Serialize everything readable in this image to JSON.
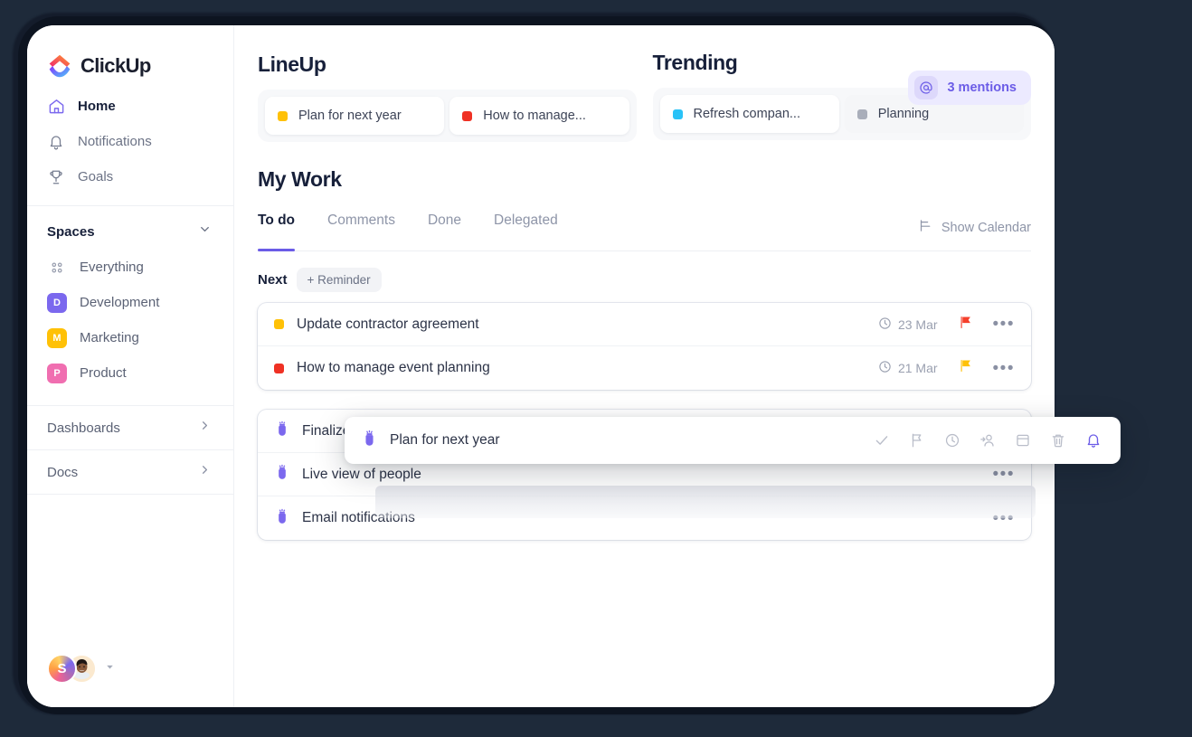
{
  "app": {
    "brand": "ClickUp"
  },
  "sidebar": {
    "nav": [
      {
        "label": "Home",
        "icon": "home-icon",
        "active": true
      },
      {
        "label": "Notifications",
        "icon": "bell-icon",
        "active": false
      },
      {
        "label": "Goals",
        "icon": "trophy-icon",
        "active": false
      }
    ],
    "spaces_title": "Spaces",
    "spaces": [
      {
        "label": "Everything",
        "badge": "",
        "color": "",
        "icon": "grid-dots-icon"
      },
      {
        "label": "Development",
        "badge": "D",
        "color": "#7b68ee"
      },
      {
        "label": "Marketing",
        "badge": "M",
        "color": "#ffc107"
      },
      {
        "label": "Product",
        "badge": "P",
        "color": "#f06eb0"
      }
    ],
    "sections": [
      {
        "label": "Dashboards",
        "icon": "chevron-right-icon"
      },
      {
        "label": "Docs",
        "icon": "chevron-right-icon"
      }
    ],
    "user": {
      "initial": "S",
      "avatar_alt": "user-photo"
    }
  },
  "lineup": {
    "title": "LineUp",
    "items": [
      {
        "label": "Plan for next year",
        "color": "#ffc107"
      },
      {
        "label": "How to manage...",
        "color": "#ef3124"
      }
    ]
  },
  "trending": {
    "title": "Trending",
    "items": [
      {
        "label": "Refresh compan...",
        "color": "#29c2f7"
      },
      {
        "label": "Planning",
        "color": "#a9aeba"
      }
    ]
  },
  "mentions": {
    "label": "3 mentions",
    "icon": "at-icon",
    "accent": "#6b5ce7"
  },
  "my_work": {
    "title": "My Work",
    "tabs": [
      {
        "label": "To do",
        "active": true
      },
      {
        "label": "Comments",
        "active": false
      },
      {
        "label": "Done",
        "active": false
      },
      {
        "label": "Delegated",
        "active": false
      }
    ],
    "show_calendar": "Show Calendar",
    "next_label": "Next",
    "reminder_button": "+ Reminder",
    "tasks": [
      {
        "name": "Update contractor agreement",
        "color": "#ffc107",
        "due": "23 Mar",
        "flag_color": "#f5402c",
        "menu": "•••"
      },
      {
        "name": "How to manage event planning",
        "color": "#ef3124",
        "due": "21 Mar",
        "flag_color": "#ffc107",
        "menu": "•••"
      }
    ],
    "reminders": [
      {
        "name": "Finalize project scope",
        "menu": "•••"
      },
      {
        "name": "Live view of people",
        "menu": "•••"
      },
      {
        "name": "Email notifications",
        "menu": "•••"
      }
    ]
  },
  "drag_card": {
    "name": "Plan for next year",
    "tools": [
      {
        "name": "check-icon",
        "active": false
      },
      {
        "name": "flag-icon",
        "active": false
      },
      {
        "name": "clock-icon",
        "active": false
      },
      {
        "name": "assign-user-icon",
        "active": false
      },
      {
        "name": "calendar-icon",
        "active": false
      },
      {
        "name": "trash-icon",
        "active": false
      },
      {
        "name": "bell-icon",
        "active": true
      }
    ],
    "active_color": "#6b5ce7"
  }
}
